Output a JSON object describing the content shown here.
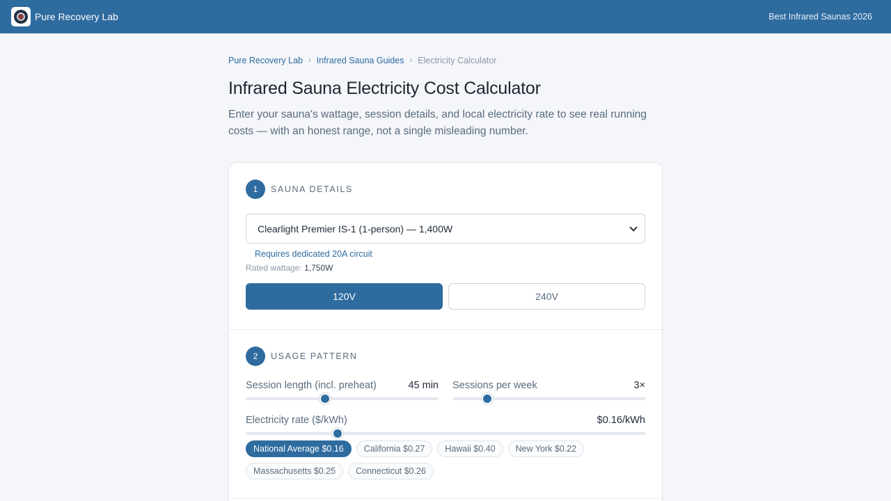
{
  "header": {
    "brand": "Pure Recovery Lab",
    "right_link": "Best Infrared Saunas 2026",
    "logo_icon": "brand-logo-icon"
  },
  "breadcrumb": {
    "items": [
      "Pure Recovery Lab",
      "Infrared Sauna Guides"
    ],
    "current": "Electricity Calculator",
    "separator": "›"
  },
  "page": {
    "title": "Infrared Sauna Electricity Cost Calculator",
    "subtitle": "Enter your sauna's wattage, session details, and local electricity rate to see real running costs — with an honest range, not a single misleading number."
  },
  "section1": {
    "step": "1",
    "label": "Sauna Details",
    "select_value": "Clearlight Premier IS-1 (1-person) — 1,400W",
    "note": "Requires dedicated 20A circuit",
    "rated_label": "Rated wattage:",
    "rated_value": "1,750W",
    "voltage_options": [
      "120V",
      "240V"
    ],
    "voltage_selected": "120V"
  },
  "section2": {
    "step": "2",
    "label": "Usage Pattern",
    "session_length": {
      "label": "Session length (incl. preheat)",
      "value": "45 min",
      "fraction": 0.41
    },
    "sessions_per_week": {
      "label": "Sessions per week",
      "value": "3×",
      "fraction": 0.18
    },
    "rate": {
      "label": "Electricity rate ($/kWh)",
      "value": "$0.16/kWh",
      "fraction": 0.23
    },
    "presets": [
      {
        "label": "National Average $0.16",
        "active": true
      },
      {
        "label": "California $0.27",
        "active": false
      },
      {
        "label": "Hawaii $0.40",
        "active": false
      },
      {
        "label": "New York $0.22",
        "active": false
      },
      {
        "label": "Massachusetts $0.25",
        "active": false
      },
      {
        "label": "Connecticut $0.26",
        "active": false
      }
    ]
  },
  "colors": {
    "accent": "#2e6b9f",
    "background": "#f4f6f9"
  }
}
